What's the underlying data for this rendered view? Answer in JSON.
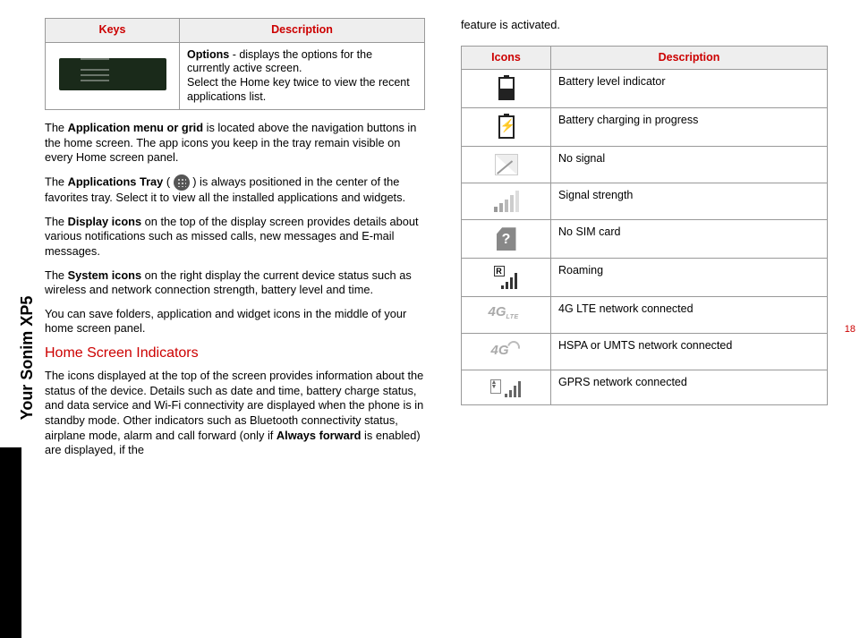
{
  "sidebar_label": "Your Sonim XP5",
  "page_number": "18",
  "left": {
    "keys_table": {
      "headers": [
        "Keys",
        "Description"
      ],
      "row": {
        "desc_bold": "Options",
        "desc_rest": " - displays the options for the currently active screen.",
        "desc_line2": "Select the Home key twice to view the recent applications list."
      }
    },
    "p1_pre": "The ",
    "p1_bold": "Application menu or grid",
    "p1_post": " is located above the navigation buttons in the home screen. The app icons you keep in the tray remain visible on every Home screen panel.",
    "p2_pre": "The ",
    "p2_bold": "Applications Tray",
    "p2_mid": " ( ",
    "p2_post": " ) is always positioned in the center of the favorites tray. Select it to view all the installed applications and widgets.",
    "p3_pre": "The ",
    "p3_bold": "Display icons",
    "p3_post": " on the top of the display screen provides details about various notifications such as missed calls, new messages and E-mail messages.",
    "p4_pre": "The ",
    "p4_bold": "System icons",
    "p4_post": " on the right display the current device status such as wireless and network connection strength, battery level and time.",
    "p5": "You can save folders, application and widget icons in the middle of your home screen panel.",
    "section_title": "Home Screen Indicators",
    "p6_a": "The icons displayed at the top of the screen provides information about the status of the device. Details such as date and time, battery charge status, and data service and Wi-Fi connectivity are displayed when the phone is in standby mode. Other indicators such as Bluetooth connectivity status, airplane mode, alarm and call forward (only if ",
    "p6_bold": "Always forward",
    "p6_b": " is enabled) are displayed, if the"
  },
  "right": {
    "intro": "feature is activated.",
    "icons_table": {
      "headers": [
        "Icons",
        "Description"
      ],
      "rows": [
        {
          "desc": "Battery level indicator"
        },
        {
          "desc": "Battery charging in progress"
        },
        {
          "desc": "No signal"
        },
        {
          "desc": "Signal strength"
        },
        {
          "desc": "No SIM card"
        },
        {
          "desc": "Roaming"
        },
        {
          "desc": "4G LTE network connected"
        },
        {
          "desc": "HSPA or UMTS network connected"
        },
        {
          "desc": "GPRS network connected"
        }
      ]
    }
  }
}
